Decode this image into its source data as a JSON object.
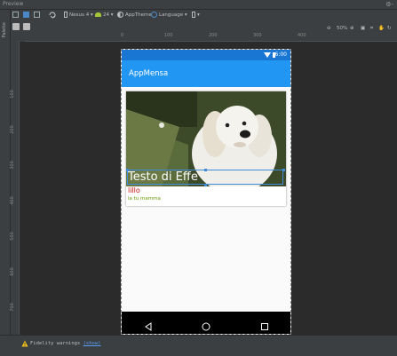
{
  "panel": {
    "title": "Preview",
    "gear": "⚙-"
  },
  "toolbar": {
    "device": "Nexus 4",
    "api": "24",
    "theme": "AppTheme",
    "language": "Language",
    "zoom": "50%"
  },
  "palette_label": "Palette",
  "ruler": {
    "top": [
      "0",
      "100",
      "200",
      "300",
      "400"
    ],
    "left": [
      "100",
      "200",
      "300",
      "400",
      "500",
      "600",
      "700",
      "800"
    ]
  },
  "device": {
    "status_time": "6:00",
    "app_title": "AppMensa",
    "card": {
      "title": "Testo di Effe",
      "name": "lillo",
      "subtitle": "la tu mamma"
    }
  },
  "bottom": {
    "warning_text": "Fidelity warnings",
    "link": "(show)"
  },
  "colors": {
    "status_bar": "#1976d2",
    "app_bar": "#2196f3",
    "name_text": "#cc1111",
    "subtitle_text": "#669900",
    "selection": "#3e8ddd"
  },
  "icons": [
    "design-icon",
    "blueprint-icon",
    "orientation-icon",
    "phone-icon",
    "android-icon",
    "theme-icon",
    "globe-icon",
    "zoom-out-icon",
    "zoom-in-icon",
    "pan-icon",
    "refresh-icon"
  ]
}
